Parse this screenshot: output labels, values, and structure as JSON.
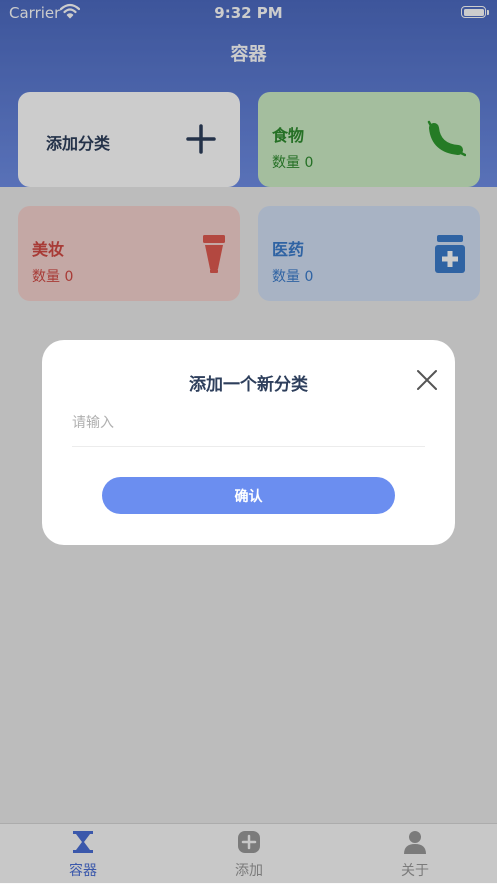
{
  "status_bar": {
    "carrier": "Carrier",
    "time": "9:32 PM"
  },
  "header": {
    "title": "容器"
  },
  "cards": [
    {
      "name": "添加分类",
      "icon": "plus-icon"
    },
    {
      "name": "食物",
      "count": "数量 0",
      "icon": "sausage-icon",
      "color": "#2f8c2f"
    },
    {
      "name": "美妆",
      "count": "数量 0",
      "icon": "lipstick-tube-icon",
      "color": "#d24a44"
    },
    {
      "name": "医药",
      "count": "数量 0",
      "icon": "medicine-bottle-icon",
      "color": "#3b7ccc"
    }
  ],
  "modal": {
    "title": "添加一个新分类",
    "input_placeholder": "请输入",
    "input_value": "",
    "confirm_label": "确认"
  },
  "tabbar": {
    "items": [
      {
        "label": "容器",
        "icon": "hourglass-icon",
        "active": true
      },
      {
        "label": "添加",
        "icon": "plus-circle-icon",
        "active": false
      },
      {
        "label": "关于",
        "icon": "person-icon",
        "active": false
      }
    ]
  },
  "colors": {
    "header": "#5a78d6",
    "accent": "#6b8ef0",
    "tab_active": "#4a6fd6",
    "tab_inactive": "#9a9a9a"
  }
}
